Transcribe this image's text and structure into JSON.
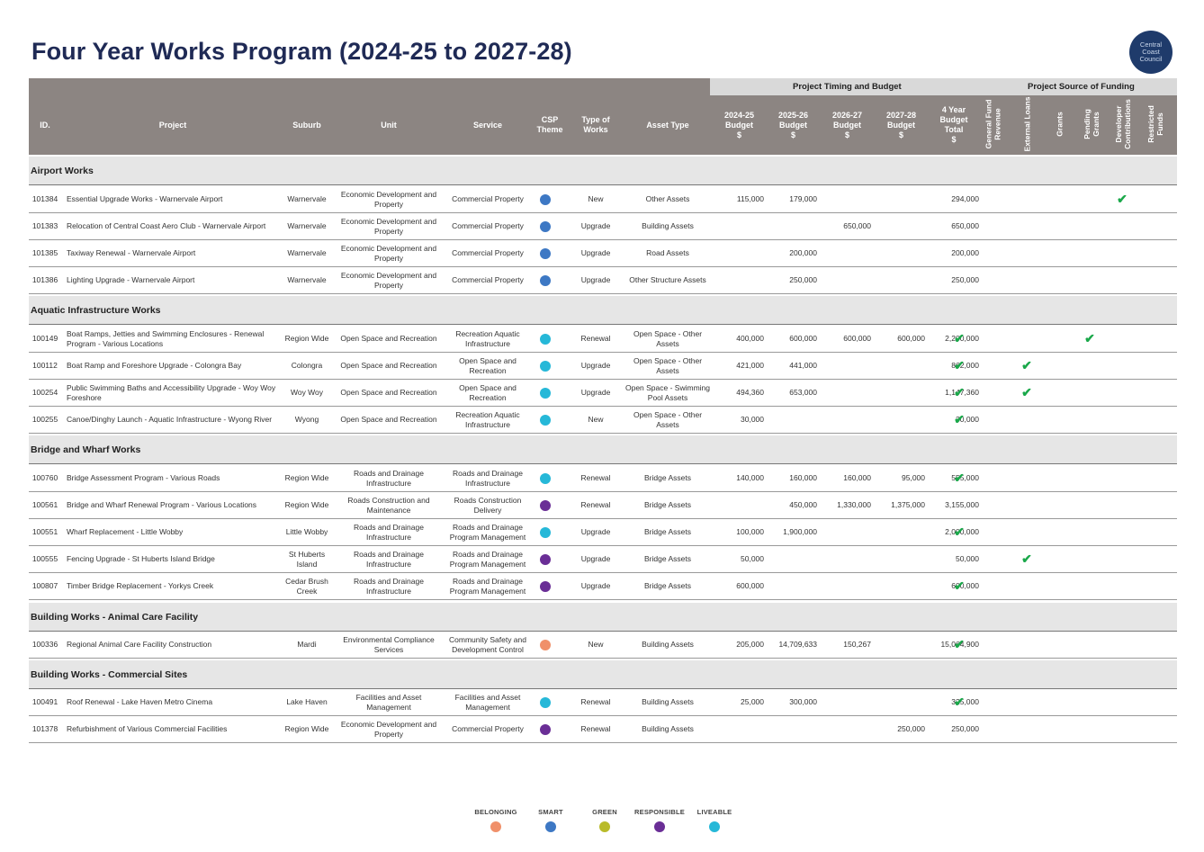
{
  "title": "Four Year Works Program (2024-25 to 2027-28)",
  "logo": {
    "line1": "Central",
    "line2": "Coast",
    "line3": "Council"
  },
  "band": {
    "timing": "Project Timing and Budget",
    "funding": "Project Source of Funding"
  },
  "headers": {
    "id": "ID.",
    "project": "Project",
    "suburb": "Suburb",
    "unit": "Unit",
    "service": "Service",
    "csp": "CSP\nTheme",
    "type": "Type of\nWorks",
    "asset": "Asset Type",
    "b1": "2024-25\nBudget\n$",
    "b2": "2025-26\nBudget\n$",
    "b3": "2026-27\nBudget\n$",
    "b4": "2027-28\nBudget\n$",
    "total": "4 Year\nBudget\nTotal\n$",
    "f1": "General Fund\nRevenue",
    "f2": "External Loans",
    "f3": "Grants",
    "f4": "Pending\nGrants",
    "f5": "Developer\nContributions",
    "f6": "Restricted\nFunds"
  },
  "theme_colors": {
    "BELONGING": "#f0906a",
    "SMART": "#3d78c4",
    "GREEN": "#b9bb2a",
    "RESPONSIBLE": "#6a2e96",
    "LIVEABLE": "#26b8d8"
  },
  "check_glyph": "✔",
  "sections": [
    {
      "title": "Airport Works",
      "rows": [
        {
          "id": "101384",
          "project": "Essential Upgrade Works - Warnervale Airport",
          "suburb": "Warnervale",
          "unit": "Economic Development and Property",
          "service": "Commercial Property",
          "theme": "SMART",
          "type": "New",
          "asset": "Other Assets",
          "b1": "115,000",
          "b2": "179,000",
          "b3": "",
          "b4": "",
          "total": "294,000",
          "funds": [
            6
          ]
        },
        {
          "id": "101383",
          "project": "Relocation of Central Coast Aero Club - Warnervale Airport",
          "suburb": "Warnervale",
          "unit": "Economic Development and Property",
          "service": "Commercial Property",
          "theme": "SMART",
          "type": "Upgrade",
          "asset": "Building Assets",
          "b1": "",
          "b2": "",
          "b3": "650,000",
          "b4": "",
          "total": "650,000",
          "funds": []
        },
        {
          "id": "101385",
          "project": "Taxiway Renewal - Warnervale Airport",
          "suburb": "Warnervale",
          "unit": "Economic Development and Property",
          "service": "Commercial Property",
          "theme": "SMART",
          "type": "Upgrade",
          "asset": "Road Assets",
          "b1": "",
          "b2": "200,000",
          "b3": "",
          "b4": "",
          "total": "200,000",
          "funds": []
        },
        {
          "id": "101386",
          "project": "Lighting Upgrade - Warnervale Airport",
          "suburb": "Warnervale",
          "unit": "Economic Development and Property",
          "service": "Commercial Property",
          "theme": "SMART",
          "type": "Upgrade",
          "asset": "Other Structure Assets",
          "b1": "",
          "b2": "250,000",
          "b3": "",
          "b4": "",
          "total": "250,000",
          "funds": []
        }
      ]
    },
    {
      "title": "Aquatic Infrastructure Works",
      "rows": [
        {
          "id": "100149",
          "project": "Boat Ramps, Jetties and Swimming Enclosures - Renewal Program - Various Locations",
          "suburb": "Region Wide",
          "unit": "Open Space and Recreation",
          "service": "Recreation Aquatic Infrastructure",
          "theme": "LIVEABLE",
          "type": "Renewal",
          "asset": "Open Space - Other Assets",
          "b1": "400,000",
          "b2": "600,000",
          "b3": "600,000",
          "b4": "600,000",
          "total": "2,200,000",
          "funds": [
            1,
            5
          ]
        },
        {
          "id": "100112",
          "project": "Boat Ramp and Foreshore Upgrade - Colongra Bay",
          "suburb": "Colongra",
          "unit": "Open Space and Recreation",
          "service": "Open Space and Recreation",
          "theme": "LIVEABLE",
          "type": "Upgrade",
          "asset": "Open Space - Other Assets",
          "b1": "421,000",
          "b2": "441,000",
          "b3": "",
          "b4": "",
          "total": "862,000",
          "funds": [
            1,
            3
          ]
        },
        {
          "id": "100254",
          "project": "Public Swimming Baths and Accessibility Upgrade - Woy Woy Foreshore",
          "suburb": "Woy Woy",
          "unit": "Open Space and Recreation",
          "service": "Open Space and Recreation",
          "theme": "LIVEABLE",
          "type": "Upgrade",
          "asset": "Open Space - Swimming Pool Assets",
          "b1": "494,360",
          "b2": "653,000",
          "b3": "",
          "b4": "",
          "total": "1,147,360",
          "funds": [
            1,
            3
          ]
        },
        {
          "id": "100255",
          "project": "Canoe/Dinghy Launch - Aquatic Infrastructure - Wyong River",
          "suburb": "Wyong",
          "unit": "Open Space and Recreation",
          "service": "Recreation Aquatic Infrastructure",
          "theme": "LIVEABLE",
          "type": "New",
          "asset": "Open Space - Other Assets",
          "b1": "30,000",
          "b2": "",
          "b3": "",
          "b4": "",
          "total": "30,000",
          "funds": [
            1
          ]
        }
      ]
    },
    {
      "title": "Bridge and Wharf Works",
      "rows": [
        {
          "id": "100760",
          "project": "Bridge Assessment Program - Various Roads",
          "suburb": "Region Wide",
          "unit": "Roads and Drainage Infrastructure",
          "service": "Roads and Drainage Infrastructure",
          "theme": "LIVEABLE",
          "type": "Renewal",
          "asset": "Bridge Assets",
          "b1": "140,000",
          "b2": "160,000",
          "b3": "160,000",
          "b4": "95,000",
          "total": "555,000",
          "funds": [
            1
          ]
        },
        {
          "id": "100561",
          "project": "Bridge and Wharf Renewal Program - Various Locations",
          "suburb": "Region Wide",
          "unit": "Roads Construction and Maintenance",
          "service": "Roads Construction Delivery",
          "theme": "RESPONSIBLE",
          "type": "Renewal",
          "asset": "Bridge Assets",
          "b1": "",
          "b2": "450,000",
          "b3": "1,330,000",
          "b4": "1,375,000",
          "total": "3,155,000",
          "funds": []
        },
        {
          "id": "100551",
          "project": "Wharf Replacement - Little Wobby",
          "suburb": "Little Wobby",
          "unit": "Roads and Drainage Infrastructure",
          "service": "Roads and Drainage Program Management",
          "theme": "LIVEABLE",
          "type": "Upgrade",
          "asset": "Bridge Assets",
          "b1": "100,000",
          "b2": "1,900,000",
          "b3": "",
          "b4": "",
          "total": "2,000,000",
          "funds": [
            1
          ]
        },
        {
          "id": "100555",
          "project": "Fencing Upgrade - St Huberts Island Bridge",
          "suburb": "St Huberts Island",
          "unit": "Roads and Drainage Infrastructure",
          "service": "Roads and Drainage Program Management",
          "theme": "RESPONSIBLE",
          "type": "Upgrade",
          "asset": "Bridge Assets",
          "b1": "50,000",
          "b2": "",
          "b3": "",
          "b4": "",
          "total": "50,000",
          "funds": [
            3
          ]
        },
        {
          "id": "100807",
          "project": "Timber Bridge Replacement - Yorkys Creek",
          "suburb": "Cedar Brush Creek",
          "unit": "Roads and Drainage Infrastructure",
          "service": "Roads and Drainage Program Management",
          "theme": "RESPONSIBLE",
          "type": "Upgrade",
          "asset": "Bridge Assets",
          "b1": "600,000",
          "b2": "",
          "b3": "",
          "b4": "",
          "total": "600,000",
          "funds": [
            1
          ]
        }
      ]
    },
    {
      "title": "Building Works - Animal Care Facility",
      "rows": [
        {
          "id": "100336",
          "project": "Regional Animal Care Facility Construction",
          "suburb": "Mardi",
          "unit": "Environmental Compliance Services",
          "service": "Community Safety and Development Control",
          "theme": "BELONGING",
          "type": "New",
          "asset": "Building Assets",
          "b1": "205,000",
          "b2": "14,709,633",
          "b3": "150,267",
          "b4": "",
          "total": "15,064,900",
          "funds": [
            1
          ]
        }
      ]
    },
    {
      "title": "Building Works - Commercial Sites",
      "rows": [
        {
          "id": "100491",
          "project": "Roof Renewal - Lake Haven Metro Cinema",
          "suburb": "Lake Haven",
          "unit": "Facilities and Asset Management",
          "service": "Facilities and Asset Management",
          "theme": "LIVEABLE",
          "type": "Renewal",
          "asset": "Building Assets",
          "b1": "25,000",
          "b2": "300,000",
          "b3": "",
          "b4": "",
          "total": "325,000",
          "funds": [
            1
          ]
        },
        {
          "id": "101378",
          "project": "Refurbishment of Various Commercial Facilities",
          "suburb": "Region Wide",
          "unit": "Economic Development and Property",
          "service": "Commercial Property",
          "theme": "RESPONSIBLE",
          "type": "Renewal",
          "asset": "Building Assets",
          "b1": "",
          "b2": "",
          "b3": "",
          "b4": "250,000",
          "total": "250,000",
          "funds": []
        }
      ]
    }
  ],
  "legend": [
    "BELONGING",
    "SMART",
    "GREEN",
    "RESPONSIBLE",
    "LIVEABLE"
  ]
}
